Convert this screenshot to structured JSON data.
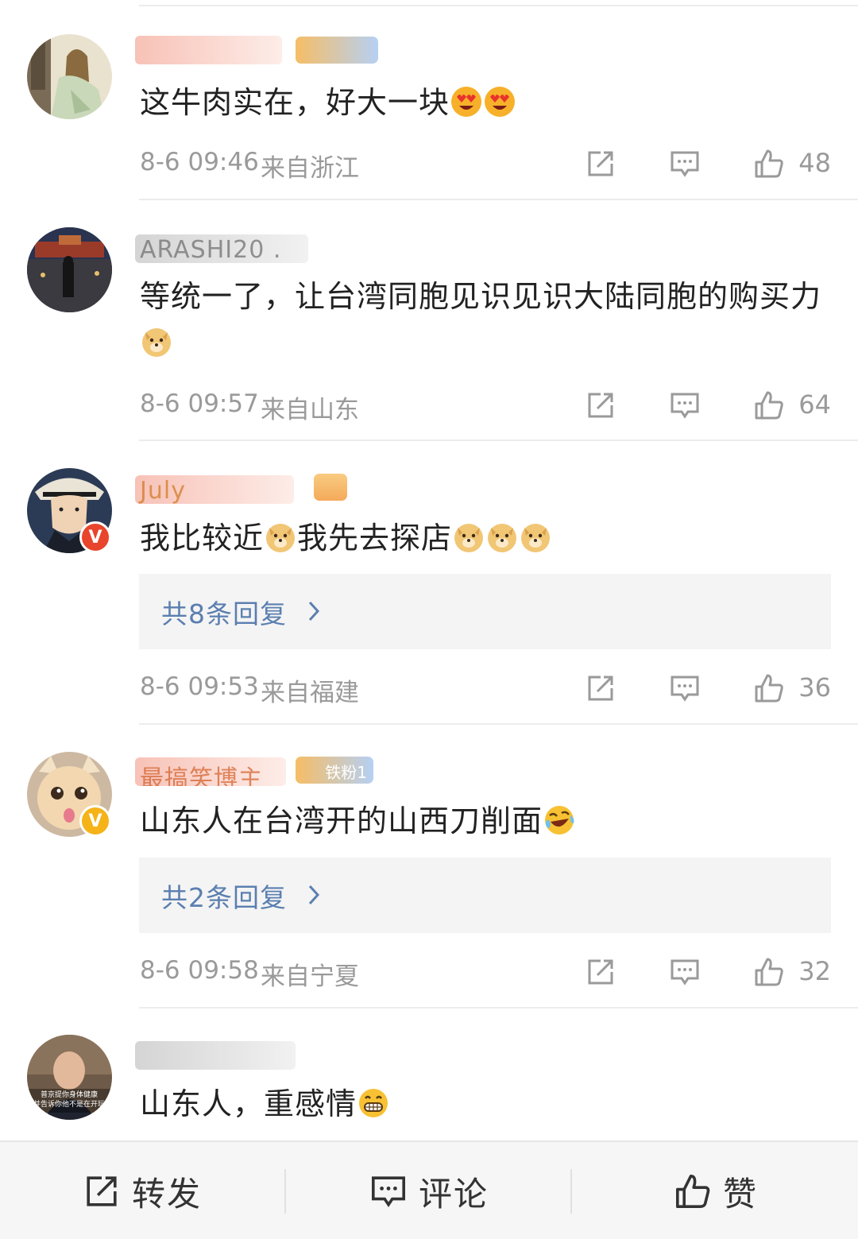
{
  "comments": [
    {
      "name": "",
      "tag": "",
      "content": "这牛肉实在，好大一块",
      "time": "8-6 09:46",
      "location": "来自浙江",
      "likes": "48",
      "emojis": [
        "heart-eyes",
        "heart-eyes"
      ],
      "avatar": "avatar-woman-painting"
    },
    {
      "name": "ARASHI20 .",
      "tag": "",
      "content": "等统一了，让台湾同胞见识见识大陆同胞的购买力",
      "time": "8-6 09:57",
      "location": "来自山东",
      "likes": "64",
      "emojis": [
        "doge"
      ],
      "avatar": "avatar-night-street"
    },
    {
      "name": "July",
      "tag": "",
      "content_a": "我比较近",
      "content_b": "我先去探店",
      "time": "8-6 09:53",
      "location": "来自福建",
      "likes": "36",
      "replies": "共8条回复",
      "avatar": "avatar-anime-man"
    },
    {
      "name": "最搞笑博主",
      "tag": "铁粉1",
      "content": "山东人在台湾开的山西刀削面",
      "time": "8-6 09:58",
      "location": "来自宁夏",
      "likes": "32",
      "replies": "共2条回复",
      "avatar": "avatar-cat"
    },
    {
      "name": "",
      "tag": "",
      "content": "山东人，重感情",
      "avatar": "avatar-man-caption",
      "avatar_caption_1": "普京提你身体健康",
      "avatar_caption_2": "并告诉你他不是在开玩"
    }
  ],
  "bottom_bar": {
    "repost": "转发",
    "comment": "评论",
    "like": "赞"
  },
  "colors": {
    "link": "#5b7fb0",
    "meta": "#9a9a9a",
    "badge_red": "#e8452c",
    "badge_gold": "#f5b318"
  }
}
